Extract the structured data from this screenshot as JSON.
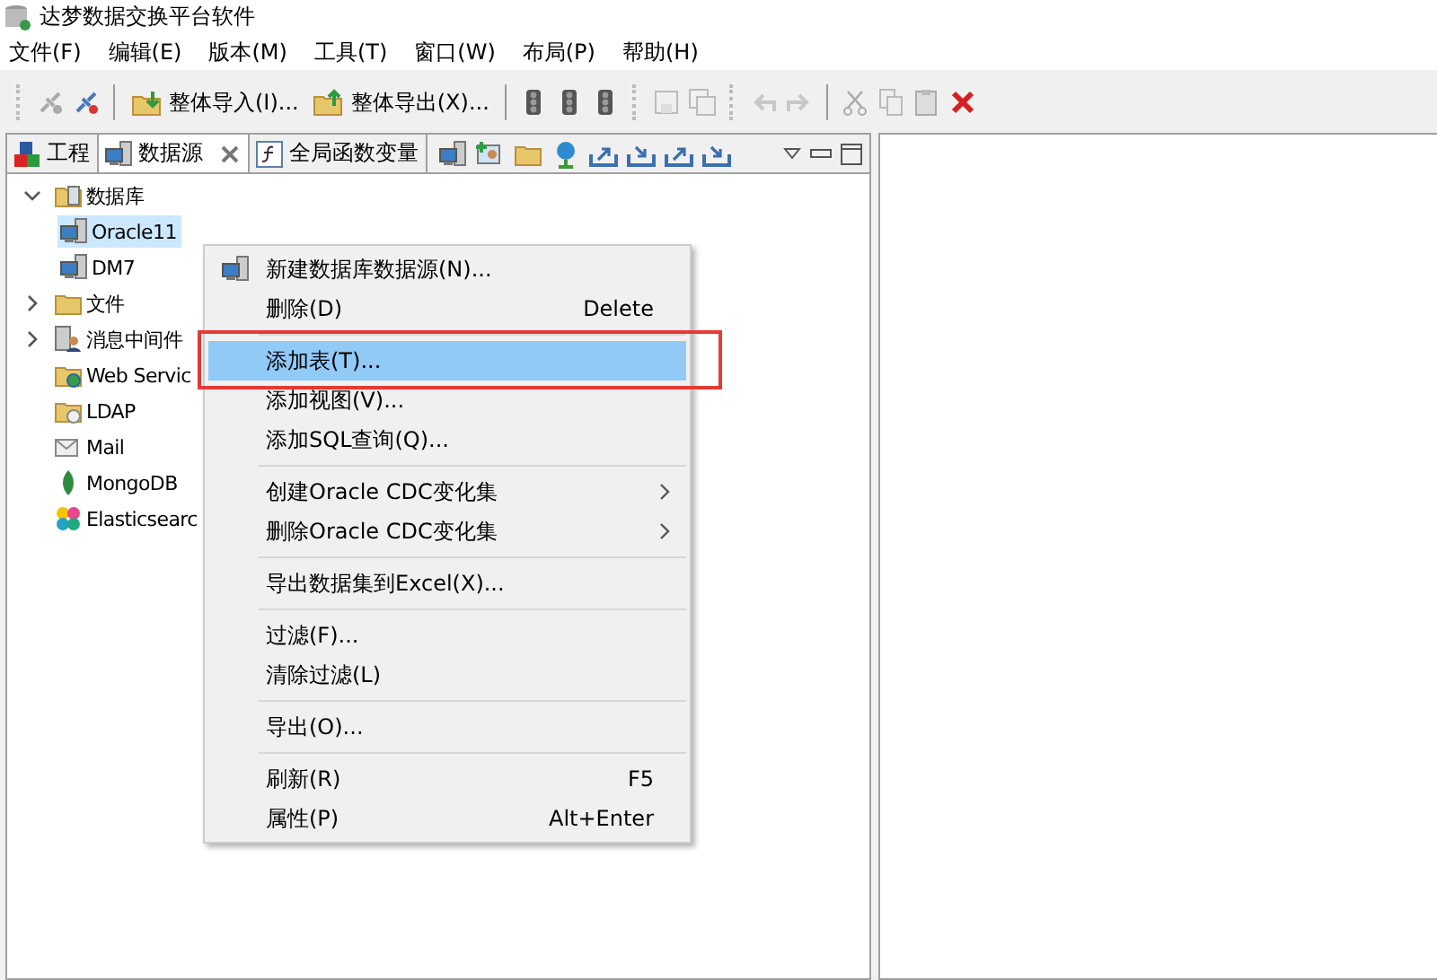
{
  "window": {
    "title": "达梦数据交换平台软件"
  },
  "menu_bar": [
    "文件(F)",
    "编辑(E)",
    "版本(M)",
    "工具(T)",
    "窗口(W)",
    "布局(P)",
    "帮助(H)"
  ],
  "toolbar": {
    "buttons": [
      {
        "label": "整体导入(I)..."
      },
      {
        "label": "整体导出(X)..."
      }
    ]
  },
  "panel_tabs": [
    {
      "label": "工程",
      "selected": false,
      "closable": false
    },
    {
      "label": "数据源",
      "selected": true,
      "closable": true
    },
    {
      "label": "全局函数变量",
      "selected": false,
      "closable": false
    }
  ],
  "tree": [
    {
      "label": "数据库",
      "expanded": true,
      "selected": false,
      "children": [
        {
          "label": "Oracle11",
          "selected": true
        },
        {
          "label": "DM7",
          "selected": false
        }
      ]
    },
    {
      "label": "文件",
      "expanded": false,
      "selected": false
    },
    {
      "label": "消息中间件",
      "expanded": false,
      "selected": false
    },
    {
      "label": "Web Servic",
      "selected": false
    },
    {
      "label": "LDAP",
      "selected": false
    },
    {
      "label": "Mail",
      "selected": false
    },
    {
      "label": "MongoDB",
      "selected": false
    },
    {
      "label": "Elasticsearc",
      "selected": false
    }
  ],
  "context_menu": [
    {
      "kind": "item",
      "label": "新建数据库数据源(N)...",
      "has_icon": true,
      "selected": false
    },
    {
      "kind": "item",
      "label": "删除(D)",
      "shortcut": "Delete",
      "selected": false
    },
    {
      "kind": "separator"
    },
    {
      "kind": "item",
      "label": "添加表(T)...",
      "selected": true
    },
    {
      "kind": "item",
      "label": "添加视图(V)...",
      "selected": false
    },
    {
      "kind": "item",
      "label": "添加SQL查询(Q)...",
      "selected": false
    },
    {
      "kind": "separator"
    },
    {
      "kind": "item",
      "label": "创建Oracle CDC变化集",
      "submenu": true,
      "selected": false
    },
    {
      "kind": "item",
      "label": "删除Oracle CDC变化集",
      "submenu": true,
      "selected": false
    },
    {
      "kind": "separator"
    },
    {
      "kind": "item",
      "label": "导出数据集到Excel(X)...",
      "selected": false
    },
    {
      "kind": "separator"
    },
    {
      "kind": "item",
      "label": "过滤(F)...",
      "selected": false
    },
    {
      "kind": "item",
      "label": "清除过滤(L)",
      "selected": false
    },
    {
      "kind": "separator"
    },
    {
      "kind": "item",
      "label": "导出(O)...",
      "selected": false
    },
    {
      "kind": "separator"
    },
    {
      "kind": "item",
      "label": "刷新(R)",
      "shortcut": "F5",
      "selected": false
    },
    {
      "kind": "item",
      "label": "属性(P)",
      "shortcut": "Alt+Enter",
      "selected": false
    }
  ]
}
